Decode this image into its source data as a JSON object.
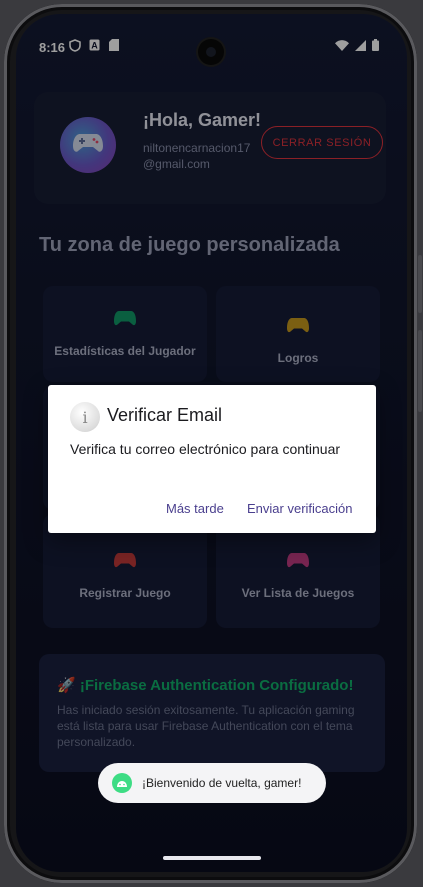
{
  "status_bar": {
    "time": "8:16",
    "left_icons": [
      "shield-icon",
      "font-icon",
      "sd-card-icon"
    ],
    "right_icons": [
      "wifi-icon",
      "signal-icon",
      "battery-icon"
    ]
  },
  "profile": {
    "greeting": "¡Hola, Gamer!",
    "email": "niltonencarnacion17@gmail.com",
    "logout_label": "CERRAR SESIÓN",
    "avatar_icon": "gamepad-icon"
  },
  "section_title": "Tu zona de juego personalizada",
  "tiles": [
    {
      "label": "Estadísticas del Jugador",
      "icon": "gamepad-icon",
      "color": "#119a68"
    },
    {
      "label": "Logros",
      "icon": "gamepad-icon",
      "color": "#c79a1e"
    },
    {
      "label": "Registrar Juego",
      "icon": "gamepad-icon",
      "color": "#c33a3a"
    },
    {
      "label": "Ver Lista de Juegos",
      "icon": "gamepad-icon",
      "color": "#c23d83"
    }
  ],
  "info": {
    "title": "🚀 ¡Firebase Authentication Configurado!",
    "text": "Has iniciado sesión exitosamente. Tu aplicación gaming está lista para usar Firebase Authentication con el tema personalizado."
  },
  "dialog": {
    "title": "Verificar Email",
    "message": "Verifica tu correo electrónico para continuar",
    "later_label": "Más tarde",
    "send_label": "Enviar verificación"
  },
  "toast": {
    "text": "¡Bienvenido de vuelta, gamer!"
  },
  "colors": {
    "accent_red": "#e0343e",
    "accent_green": "#11b06a",
    "dialog_button": "#4a3f8e"
  }
}
